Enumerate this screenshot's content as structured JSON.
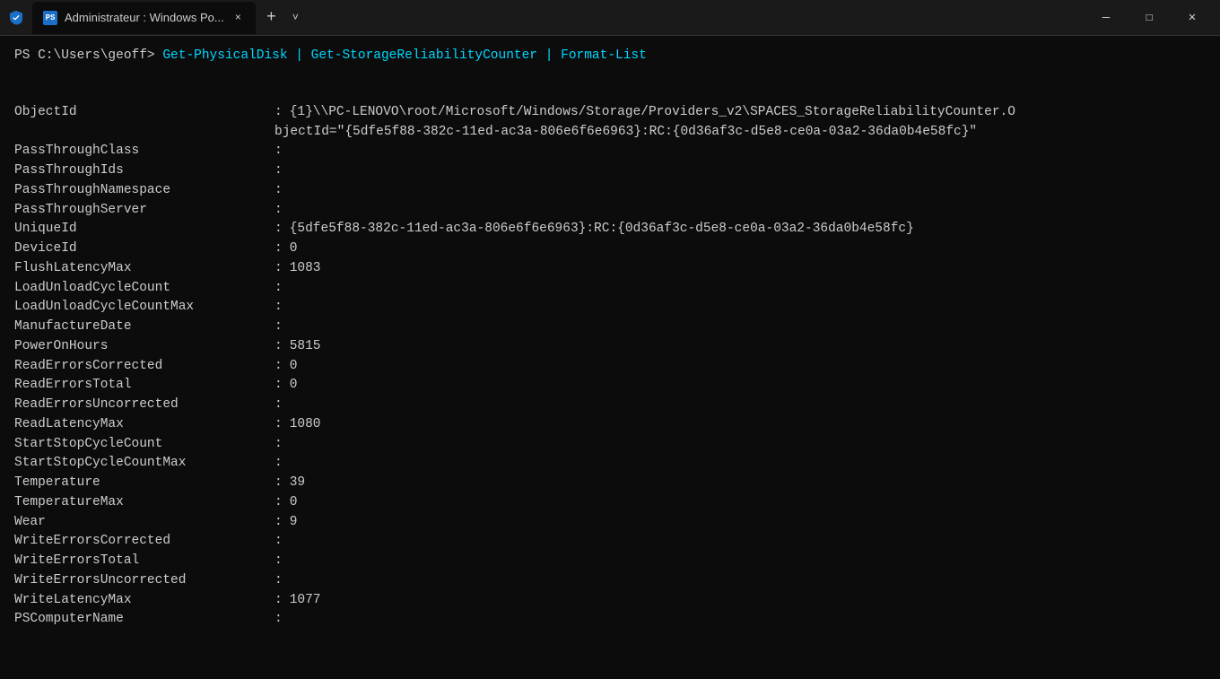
{
  "titleBar": {
    "appIcon": "shield",
    "tab": {
      "label": "Administrateur : Windows Po...",
      "closeLabel": "×"
    },
    "newTabLabel": "+",
    "dropdownLabel": "˅",
    "controls": {
      "minimize": "—",
      "maximize": "☐",
      "close": "✕"
    }
  },
  "terminal": {
    "prompt": "PS C:\\Users\\geoff>",
    "command": "Get-PhysicalDisk | Get-StorageReliabilityCounter | Format-List",
    "blankLine": "",
    "fields": [
      {
        "name": "ObjectId",
        "colon": ":",
        "value": "{1}\\\\PC-LENOVO\\root/Microsoft/Windows/Storage/Providers_v2\\SPACES_StorageReliabilityCounter.O",
        "continuation": "bjectId=\"{5dfe5f88-382c-11ed-ac3a-806e6f6e6963}:RC:{0d36af3c-d5e8-ce0a-03a2-36da0b4e58fc}\""
      },
      {
        "name": "PassThroughClass",
        "colon": ":",
        "value": ""
      },
      {
        "name": "PassThroughIds",
        "colon": ":",
        "value": ""
      },
      {
        "name": "PassThroughNamespace",
        "colon": ":",
        "value": ""
      },
      {
        "name": "PassThroughServer",
        "colon": ":",
        "value": ""
      },
      {
        "name": "UniqueId",
        "colon": ":",
        "value": "{5dfe5f88-382c-11ed-ac3a-806e6f6e6963}:RC:{0d36af3c-d5e8-ce0a-03a2-36da0b4e58fc}"
      },
      {
        "name": "DeviceId",
        "colon": ":",
        "value": "0"
      },
      {
        "name": "FlushLatencyMax",
        "colon": ":",
        "value": "1083"
      },
      {
        "name": "LoadUnloadCycleCount",
        "colon": ":",
        "value": ""
      },
      {
        "name": "LoadUnloadCycleCountMax",
        "colon": ":",
        "value": ""
      },
      {
        "name": "ManufactureDate",
        "colon": ":",
        "value": ""
      },
      {
        "name": "PowerOnHours",
        "colon": ":",
        "value": "5815"
      },
      {
        "name": "ReadErrorsCorrected",
        "colon": ":",
        "value": "0"
      },
      {
        "name": "ReadErrorsTotal",
        "colon": ":",
        "value": "0"
      },
      {
        "name": "ReadErrorsUncorrected",
        "colon": ":",
        "value": ""
      },
      {
        "name": "ReadLatencyMax",
        "colon": ":",
        "value": "1080"
      },
      {
        "name": "StartStopCycleCount",
        "colon": ":",
        "value": ""
      },
      {
        "name": "StartStopCycleCountMax",
        "colon": ":",
        "value": ""
      },
      {
        "name": "Temperature",
        "colon": ":",
        "value": "39"
      },
      {
        "name": "TemperatureMax",
        "colon": ":",
        "value": "0"
      },
      {
        "name": "Wear",
        "colon": ":",
        "value": "9"
      },
      {
        "name": "WriteErrorsCorrected",
        "colon": ":",
        "value": ""
      },
      {
        "name": "WriteErrorsTotal",
        "colon": ":",
        "value": ""
      },
      {
        "name": "WriteErrorsUncorrected",
        "colon": ":",
        "value": ""
      },
      {
        "name": "WriteLatencyMax",
        "colon": ":",
        "value": "1077"
      },
      {
        "name": "PSComputerName",
        "colon": ":",
        "value": ""
      }
    ]
  }
}
